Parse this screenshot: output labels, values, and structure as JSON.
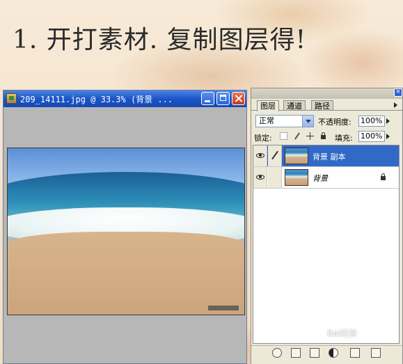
{
  "slide": {
    "heading": "1. 开打素材. 复制图层得!"
  },
  "document_window": {
    "title": "209_14111.jpg @ 33.3% (背景 ...",
    "controls": [
      "minimize",
      "maximize",
      "close"
    ]
  },
  "layers_panel": {
    "tabs": [
      {
        "label": "图层",
        "active": true
      },
      {
        "label": "通道",
        "active": false
      },
      {
        "label": "路径",
        "active": false
      }
    ],
    "blend_mode": "正常",
    "opacity_label": "不透明度:",
    "opacity_value": "100%",
    "lock_label": "锁定:",
    "fill_label": "填充:",
    "fill_value": "100%",
    "layers": [
      {
        "name": "背景 副本",
        "selected": true,
        "visible": true,
        "locked": false
      },
      {
        "name": "背景",
        "selected": false,
        "visible": true,
        "locked": true
      }
    ],
    "bottom_buttons": [
      "link-layers",
      "layer-style",
      "layer-mask",
      "adjustment-layer",
      "new-layer",
      "delete-layer"
    ]
  },
  "watermark": {
    "text": "Bai经验"
  },
  "colors": {
    "titlebar": "#1b55c9",
    "selected_layer": "#3169c6",
    "panel_bg": "#ece9d8"
  }
}
